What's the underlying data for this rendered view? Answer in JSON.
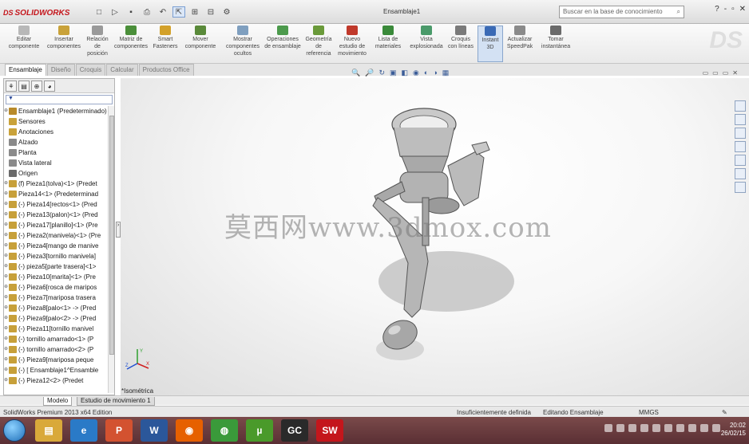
{
  "window": {
    "app_name": "SOLIDWORKS",
    "doc_title": "Ensamblaje1",
    "search_placeholder": "Buscar en la base de conocimiento",
    "controls": [
      "?",
      "-",
      "▫",
      "✕"
    ]
  },
  "quick_access": [
    "new-icon",
    "open-icon",
    "save-icon",
    "print-icon",
    "undo-icon",
    "select-icon",
    "rebuild-icon",
    "file-props-icon",
    "options-icon"
  ],
  "ribbon": {
    "buttons": [
      {
        "label": "Editar componente",
        "color": "#b8b8b8"
      },
      {
        "label": "Insertar componentes",
        "color": "#c9a23a"
      },
      {
        "label": "Relación de posición",
        "color": "#9a9a9a"
      },
      {
        "label": "Matriz de componentes",
        "color": "#4b8f3a"
      },
      {
        "label": "Smart Fasteners",
        "color": "#d3a12a"
      },
      {
        "label": "Mover componente",
        "color": "#5a8a3a"
      },
      {
        "label": "Mostrar componentes ocultos",
        "color": "#7f9fbf"
      },
      {
        "label": "Operaciones de ensamblaje",
        "color": "#4c9a4c"
      },
      {
        "label": "Geometría de referencia",
        "color": "#6a9a3a"
      },
      {
        "label": "Nuevo estudio de movimiento",
        "color": "#c0392b"
      },
      {
        "label": "Lista de materiales",
        "color": "#3a8a3a"
      },
      {
        "label": "Vista explosionada",
        "color": "#4a9a6a"
      },
      {
        "label": "Croquis con líneas",
        "color": "#7a7a7a"
      },
      {
        "label": "Instant 3D",
        "color": "#3a6ab5"
      },
      {
        "label": "Actualizar SpeedPak",
        "color": "#8a8a8a"
      },
      {
        "label": "Tomar instantánea",
        "color": "#6a6a6a"
      }
    ]
  },
  "command_tabs": [
    "Ensamblaje",
    "Diseño",
    "Croquis",
    "Calcular",
    "Productos Office"
  ],
  "feature_manager": {
    "tab_icons": [
      "feature-tree-icon",
      "property-icon",
      "config-icon",
      "display-icon"
    ],
    "filter": "▼",
    "tree": [
      {
        "label": "Ensamblaje1 (Predeterminado)",
        "type": "assembly"
      },
      {
        "label": "Sensores",
        "type": "folder"
      },
      {
        "label": "Anotaciones",
        "type": "folder"
      },
      {
        "label": "Alzado",
        "type": "plane"
      },
      {
        "label": "Planta",
        "type": "plane"
      },
      {
        "label": "Vista lateral",
        "type": "plane"
      },
      {
        "label": "Origen",
        "type": "origin"
      },
      {
        "label": "(f) Pieza1(tolva)<1> (Predet",
        "type": "part"
      },
      {
        "label": "Pieza14<1> (Predeterminad",
        "type": "part"
      },
      {
        "label": "(-) Pieza14[rectos<1> (Pred",
        "type": "part"
      },
      {
        "label": "(-) Pieza13(palon)<1> (Pred",
        "type": "part"
      },
      {
        "label": "(-) Pieza17[planillo]<1> (Pre",
        "type": "part"
      },
      {
        "label": "(-) Pieza2(manivela)<1> (Pre",
        "type": "part"
      },
      {
        "label": "(-) Pieza4[mango de manive",
        "type": "part"
      },
      {
        "label": "(-) Pieza3[tornillo manivela]",
        "type": "part"
      },
      {
        "label": "(-) pieza5[parte trasera]<1>",
        "type": "part"
      },
      {
        "label": "(-) Pieza10[marita]<1> (Pre",
        "type": "part"
      },
      {
        "label": "(-) Pieza6[rosca de maripos",
        "type": "part"
      },
      {
        "label": "(-) Pieza7[mariposa trasera",
        "type": "part"
      },
      {
        "label": "(-) Pieza8[palo<1> -> (Pred",
        "type": "part"
      },
      {
        "label": "(-) Pieza9[palo<2> -> (Pred",
        "type": "part"
      },
      {
        "label": "(-) Pieza11[tornillo manivel",
        "type": "part"
      },
      {
        "label": "(-) tornillo amarrado<1> (P",
        "type": "part"
      },
      {
        "label": "(-) tornillo amarrado<2> (P",
        "type": "part"
      },
      {
        "label": "(-) Pieza9[mariposa peque",
        "type": "part"
      },
      {
        "label": "(-) [ Ensamblaje1^Ensamble",
        "type": "part"
      },
      {
        "label": "(-) Pieza12<2> (Predet",
        "type": "part"
      }
    ]
  },
  "viewport": {
    "heads_up": [
      "🔍",
      "🔎",
      "↻",
      "▣",
      "◧",
      "◉",
      "◐",
      "◑",
      "▦"
    ],
    "view_controls": [
      "▭",
      "▭",
      "▭",
      "✕"
    ],
    "watermark": "莫西网www.3dmox.com",
    "view_name": "*Isométrica",
    "triad_labels": {
      "x": "X",
      "y": "Y",
      "z": "Z"
    }
  },
  "model_tabs": [
    "Modelo",
    "Estudio de movimiento 1"
  ],
  "status_bar": {
    "left": "SolidWorks Premium 2013 x64 Edition",
    "mid": "Insuficientemente definida",
    "right1": "Editando Ensamblaje",
    "units": "MMGS"
  },
  "taskbar": {
    "apps": [
      {
        "name": "file-explorer",
        "glyph": "▤",
        "color": "#d9a93a"
      },
      {
        "name": "internet-explorer",
        "glyph": "e",
        "color": "#2a7ac7"
      },
      {
        "name": "powerpoint",
        "glyph": "P",
        "color": "#d35230"
      },
      {
        "name": "word",
        "glyph": "W",
        "color": "#2b579a"
      },
      {
        "name": "firefox",
        "glyph": "◉",
        "color": "#e66000"
      },
      {
        "name": "chrome",
        "glyph": "◍",
        "color": "#3a9a3a"
      },
      {
        "name": "utorrent",
        "glyph": "µ",
        "color": "#4a9a2a"
      },
      {
        "name": "gc",
        "glyph": "GC",
        "color": "#2a2a2a"
      },
      {
        "name": "solidworks",
        "glyph": "SW",
        "color": "#c4161c"
      }
    ],
    "time": "20:02",
    "date": "26/02/15"
  }
}
